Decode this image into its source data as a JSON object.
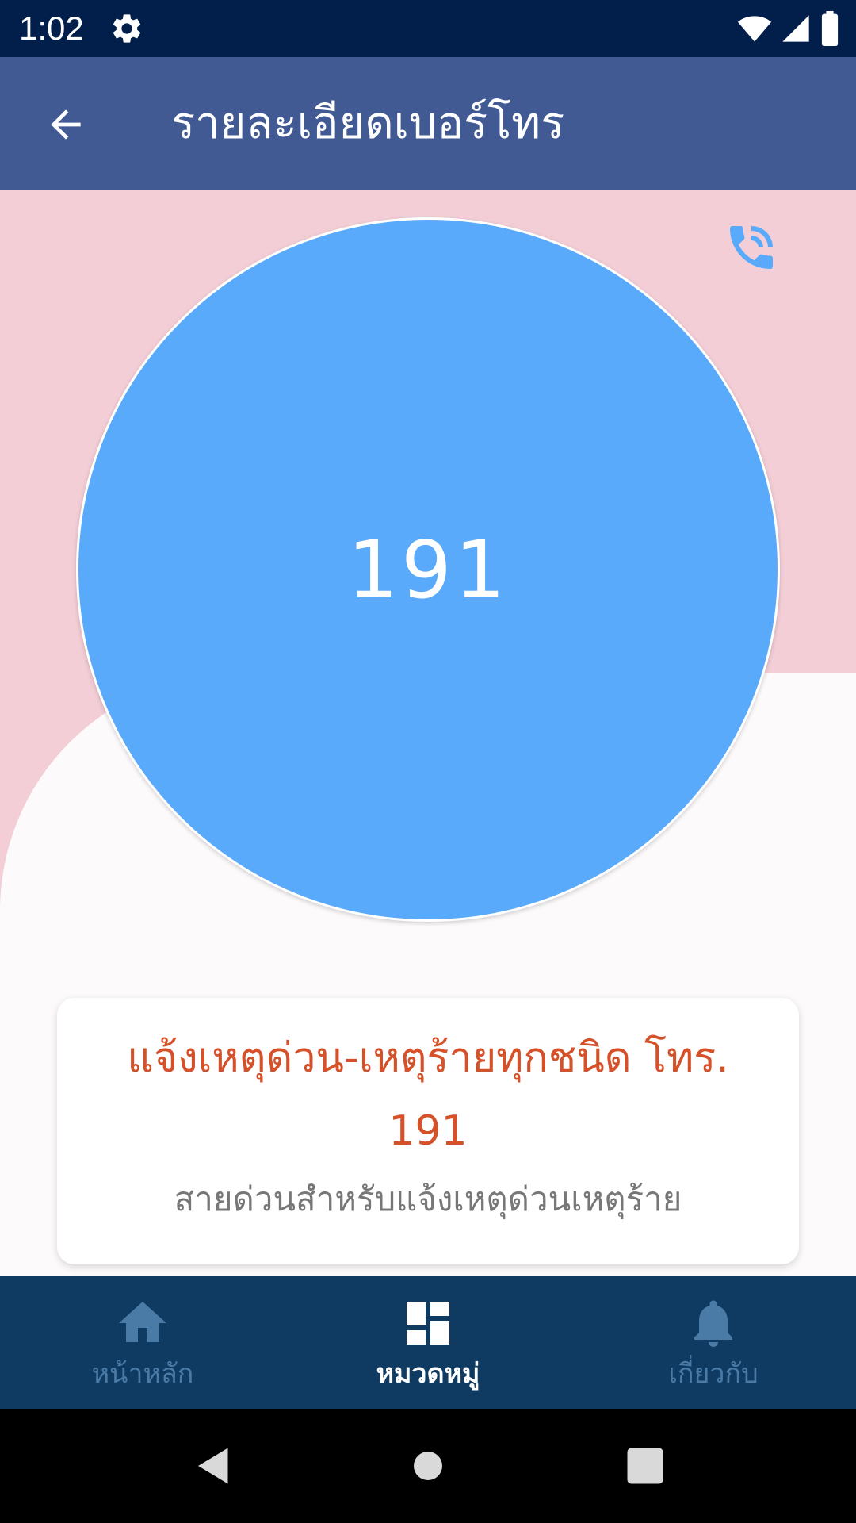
{
  "status_bar": {
    "time": "1:02",
    "icons": [
      "gear-icon",
      "wifi-icon",
      "signal-icon",
      "battery-icon"
    ]
  },
  "app_bar": {
    "title": "รายละเอียดเบอร์โทร",
    "back_icon": "arrow-left-icon"
  },
  "detail": {
    "call_icon": "phone-call-icon",
    "number": "191",
    "card_title": "แจ้งเหตุด่วน-เหตุร้ายทุกชนิด โทร. 191",
    "card_subtitle": "สายด่วนสำหรับแจ้งเหตุด่วนเหตุร้าย"
  },
  "bottom_nav": {
    "items": [
      {
        "label": "หน้าหลัก",
        "icon": "home-icon",
        "active": false
      },
      {
        "label": "หมวดหมู่",
        "icon": "dashboard-icon",
        "active": true
      },
      {
        "label": "เกี่ยวกับ",
        "icon": "bell-icon",
        "active": false
      }
    ]
  },
  "colors": {
    "status_bar": "#021e4b",
    "app_bar": "#415a94",
    "pink_background": "#f3ced6",
    "circle": "#5aaafb",
    "card_title": "#d5512a",
    "bottom_nav": "#0f3b63",
    "nav_inactive": "#4a7aa6"
  }
}
